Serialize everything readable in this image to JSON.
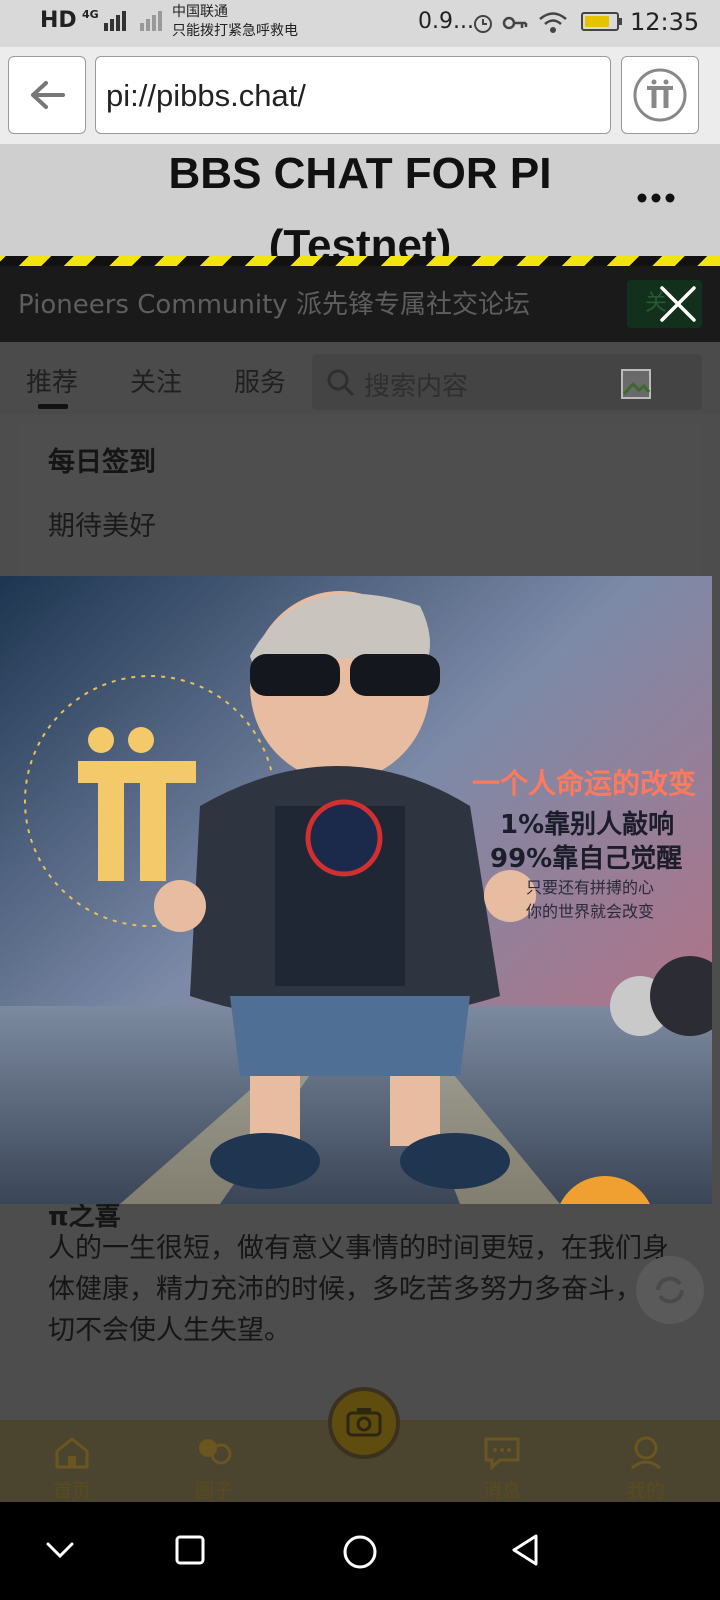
{
  "status_bar": {
    "network_left": "HD",
    "network_type": "4G",
    "carrier_line1": "中国联通",
    "carrier_line2": "只能拨打紧急呼救电",
    "speed": "0.9...",
    "time": "12:35"
  },
  "browser": {
    "url": "pi://pibbs.chat/"
  },
  "banner": {
    "title_line1": "BBS CHAT FOR PI",
    "title_line2": "(Testnet)"
  },
  "community_bar": {
    "text": "Pioneers Community 派先锋专属社交论坛",
    "button_label": "关"
  },
  "tabs": [
    "推荐",
    "关注",
    "服务"
  ],
  "search": {
    "placeholder": "搜索内容"
  },
  "checkin_card": {
    "title": "每日签到",
    "subtitle": "期待美好"
  },
  "post": {
    "title": "π之喜",
    "body": "人的一生很短，做有意义事情的时间更短，在我们身体健康，精力充沛的时候，多吃苦多努力多奋斗，一切不会使人生失望。"
  },
  "poster": {
    "line1": "一个人命运的改变",
    "line2": "1%靠别人敲响",
    "line3": "99%靠自己觉醒",
    "line4": "只要还有拼搏的心",
    "line5": "你的世界就会改变"
  },
  "bottom_nav": [
    {
      "label": "首页",
      "icon": "home-icon"
    },
    {
      "label": "圈子",
      "icon": "circle-icon"
    },
    {
      "label": "消息",
      "icon": "message-icon"
    },
    {
      "label": "我的",
      "icon": "profile-icon"
    }
  ],
  "colors": {
    "accent_yellow": "#f1e40f",
    "nav_gold": "#c9a227"
  }
}
